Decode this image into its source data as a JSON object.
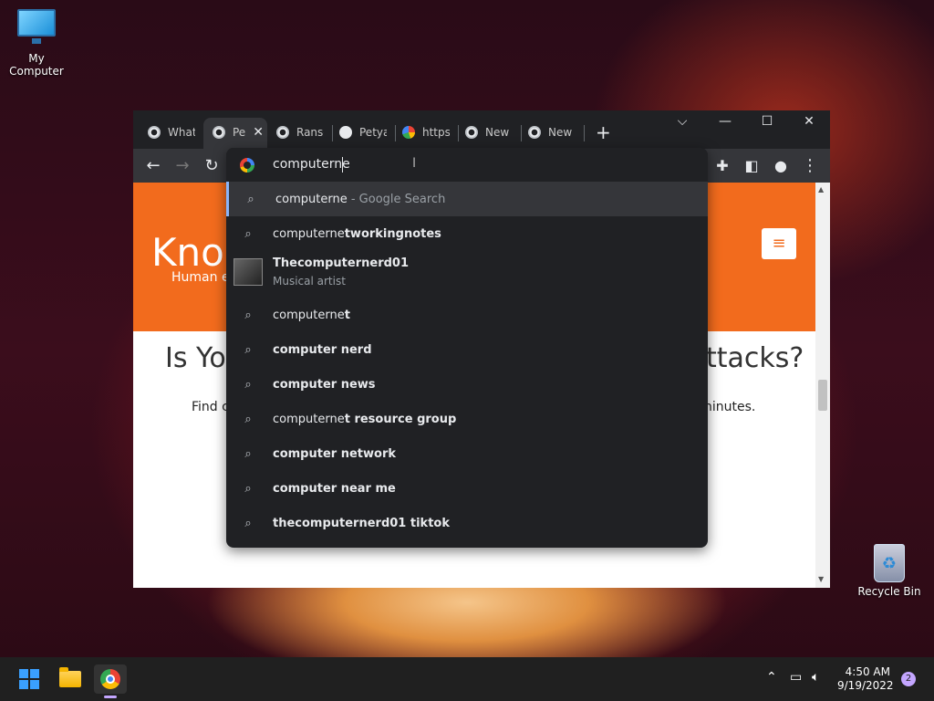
{
  "desktop": {
    "my_computer_label": "My Computer",
    "recycle_bin_label": "Recycle Bin"
  },
  "browser": {
    "tabs": [
      {
        "label": "What",
        "icon": "chrome-icon"
      },
      {
        "label": "Pe",
        "icon": "chrome-icon",
        "active": true
      },
      {
        "label": "Ranso",
        "icon": "chrome-icon"
      },
      {
        "label": "Petya",
        "icon": "github-icon"
      },
      {
        "label": "https:",
        "icon": "google-icon"
      },
      {
        "label": "New",
        "icon": "chrome-icon"
      },
      {
        "label": "New",
        "icon": "chrome-icon"
      }
    ],
    "window_controls": {
      "tab_search": "⌵",
      "minimize": "—",
      "maximize": "☐",
      "close": "✕"
    },
    "omnibox": {
      "query": "computerne"
    },
    "suggestions": [
      {
        "prefix": "computerne",
        "suffix": "",
        "secondary": " - Google Search",
        "type": "search"
      },
      {
        "prefix": "computerne",
        "suffix": "tworkingnotes",
        "type": "search"
      },
      {
        "title": "Thecomputernerd01",
        "subtitle": "Musical artist",
        "type": "entity"
      },
      {
        "prefix": "computerne",
        "suffix": "t",
        "type": "search"
      },
      {
        "prefix": "",
        "suffix": "computer nerd",
        "type": "search"
      },
      {
        "prefix": "",
        "suffix": "computer news",
        "type": "search"
      },
      {
        "prefix": "computerne",
        "suffix": "t resource group",
        "type": "search"
      },
      {
        "prefix": "",
        "suffix": "computer network",
        "type": "search"
      },
      {
        "prefix": "",
        "suffix": "computer near me",
        "type": "search"
      },
      {
        "prefix": "",
        "suffix": "thecomputernerd01 tiktok",
        "type": "search"
      }
    ]
  },
  "page": {
    "logo_text": "Kno",
    "logo_sub": "Human e",
    "headline_left": "Is You",
    "headline_right": "ttacks?",
    "sub_left": "Find c",
    "sub_right": "ninutes."
  },
  "taskbar": {
    "time": "4:50 AM",
    "date": "9/19/2022",
    "notification_count": "2"
  },
  "colors": {
    "brand_orange": "#f26b1d",
    "chrome_dark": "#202124",
    "chrome_toolbar": "#35363a",
    "accent_purple": "#c4a6ff"
  }
}
